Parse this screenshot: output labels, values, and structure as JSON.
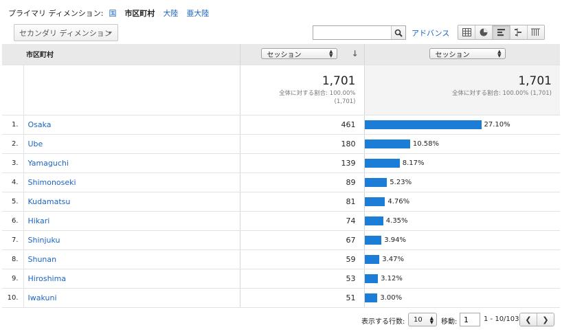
{
  "primary_dimension": {
    "label": "プライマリ ディメンション:",
    "options": [
      {
        "label": "国",
        "active": false
      },
      {
        "label": "市区町村",
        "active": true
      },
      {
        "label": "大陸",
        "active": false
      },
      {
        "label": "亜大陸",
        "active": false
      }
    ]
  },
  "toolbar": {
    "secondary_dimension_label": "セカンダリ ディメンション",
    "search_value": "",
    "advanced_label": "アドバンス",
    "view_icons": [
      "grid-icon",
      "pie-icon",
      "bar-icon",
      "comparison-icon",
      "pivot-icon"
    ],
    "active_view": "bar-icon"
  },
  "table": {
    "dimension_header": "市区町村",
    "metric1_select": "セッション",
    "metric2_select": "セッション",
    "totals": {
      "value": "1,701",
      "note_line1": "全体に対する割合: 100.00%",
      "note_line2": "(1,701)",
      "value2": "1,701",
      "note2": "全体に対する割合: 100.00% (1,701)"
    },
    "rows": [
      {
        "index": "1.",
        "city": "Osaka",
        "sessions": "461",
        "pct": "27.10%",
        "share": 27.1
      },
      {
        "index": "2.",
        "city": "Ube",
        "sessions": "180",
        "pct": "10.58%",
        "share": 10.58
      },
      {
        "index": "3.",
        "city": "Yamaguchi",
        "sessions": "139",
        "pct": "8.17%",
        "share": 8.17
      },
      {
        "index": "4.",
        "city": "Shimonoseki",
        "sessions": "89",
        "pct": "5.23%",
        "share": 5.23
      },
      {
        "index": "5.",
        "city": "Kudamatsu",
        "sessions": "81",
        "pct": "4.76%",
        "share": 4.76
      },
      {
        "index": "6.",
        "city": "Hikari",
        "sessions": "74",
        "pct": "4.35%",
        "share": 4.35
      },
      {
        "index": "7.",
        "city": "Shinjuku",
        "sessions": "67",
        "pct": "3.94%",
        "share": 3.94
      },
      {
        "index": "8.",
        "city": "Shunan",
        "sessions": "59",
        "pct": "3.47%",
        "share": 3.47
      },
      {
        "index": "9.",
        "city": "Hiroshima",
        "sessions": "53",
        "pct": "3.12%",
        "share": 3.12
      },
      {
        "index": "10.",
        "city": "Iwakuni",
        "sessions": "51",
        "pct": "3.00%",
        "share": 3.0
      }
    ]
  },
  "pager": {
    "rows_label": "表示する行数:",
    "rows_value": "10",
    "goto_label": "移動:",
    "goto_value": "1",
    "range": "1 - 10/103"
  },
  "colors": {
    "bar": "#1b7dd6",
    "link": "#1a63c7"
  }
}
